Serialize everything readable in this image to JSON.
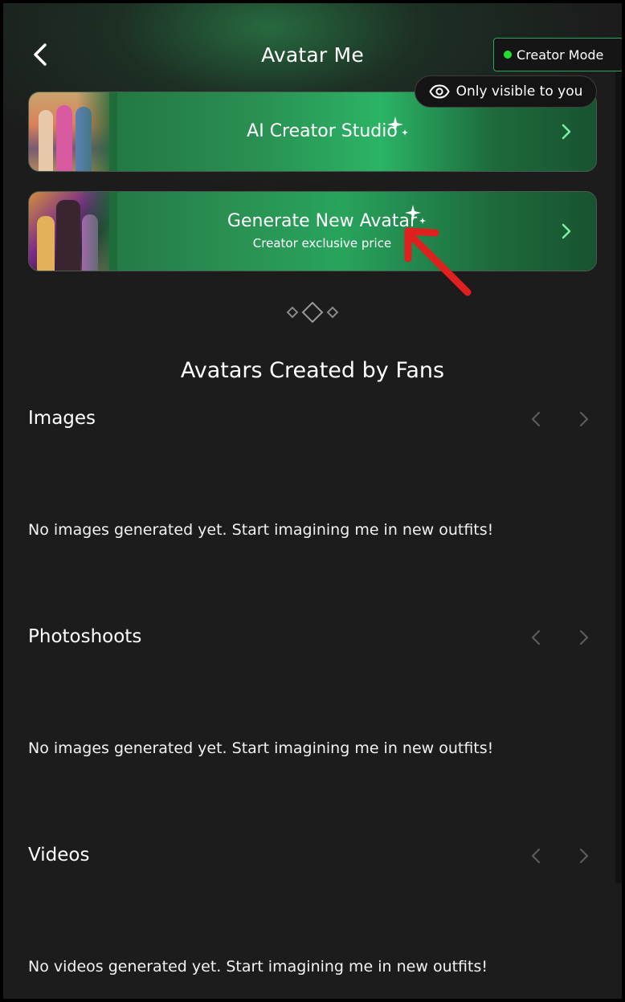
{
  "header": {
    "title": "Avatar Me",
    "creator_mode_label": "Creator Mode",
    "visibility_label": "Only visible to you"
  },
  "cards": [
    {
      "title": "AI Creator Studio"
    },
    {
      "title": "Generate New Avatar",
      "subtitle": "Creator exclusive price"
    }
  ],
  "fans_section": {
    "heading": "Avatars Created by Fans",
    "groups": [
      {
        "title": "Images",
        "empty_message": "No images generated yet. Start imagining me in new outfits!"
      },
      {
        "title": "Photoshoots",
        "empty_message": "No images generated yet. Start imagining me in new outfits!"
      },
      {
        "title": "Videos",
        "empty_message": "No videos generated yet. Start imagining me in new outfits!"
      }
    ]
  },
  "colors": {
    "background": "#1c1c1c",
    "accent_green": "#2bb465",
    "status_dot": "#22dd33",
    "annotation_red": "#e01f1f"
  },
  "icons": [
    "back-chevron-icon",
    "status-dot-icon",
    "eye-icon",
    "sparkle-icon",
    "chevron-right-icon",
    "chevron-left-icon",
    "diamond-divider-icon",
    "annotation-arrow-icon"
  ]
}
